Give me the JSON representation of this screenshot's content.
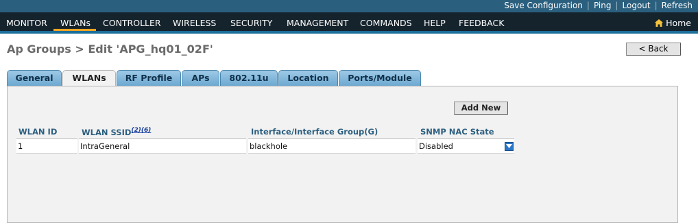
{
  "util_links": [
    "Save Configuration",
    "Ping",
    "Logout",
    "Refresh"
  ],
  "nav": [
    "MONITOR",
    "WLANs",
    "CONTROLLER",
    "WIRELESS",
    "SECURITY",
    "MANAGEMENT",
    "COMMANDS",
    "HELP",
    "FEEDBACK"
  ],
  "home_label": "Home",
  "page_title": "Ap Groups > Edit  'APG_hq01_02F'",
  "back_label": "< Back",
  "tabs": [
    "General",
    "WLANs",
    "RF Profile",
    "APs",
    "802.11u",
    "Location",
    "Ports/Module"
  ],
  "active_tab": "WLANs",
  "add_new_label": "Add New",
  "table": {
    "headers": [
      "WLAN ID",
      "WLAN SSID",
      "Interface/Interface Group(G)",
      "SNMP NAC State"
    ],
    "ssid_footnotes": "(2)(6)",
    "rows": [
      [
        "1",
        "IntraGeneral",
        "blackhole",
        "Disabled"
      ]
    ]
  },
  "colors": {
    "top_bar": "#2a5f7e",
    "nav_bar": "#15232c",
    "nav_underline": "#1c6f9a",
    "active_nav_indicator": "#f5a623",
    "tab_blue": "#8abde0",
    "header_text": "#2d5f80"
  },
  "icons": {
    "home": "home-icon",
    "dropdown": "chevron-down-icon"
  }
}
